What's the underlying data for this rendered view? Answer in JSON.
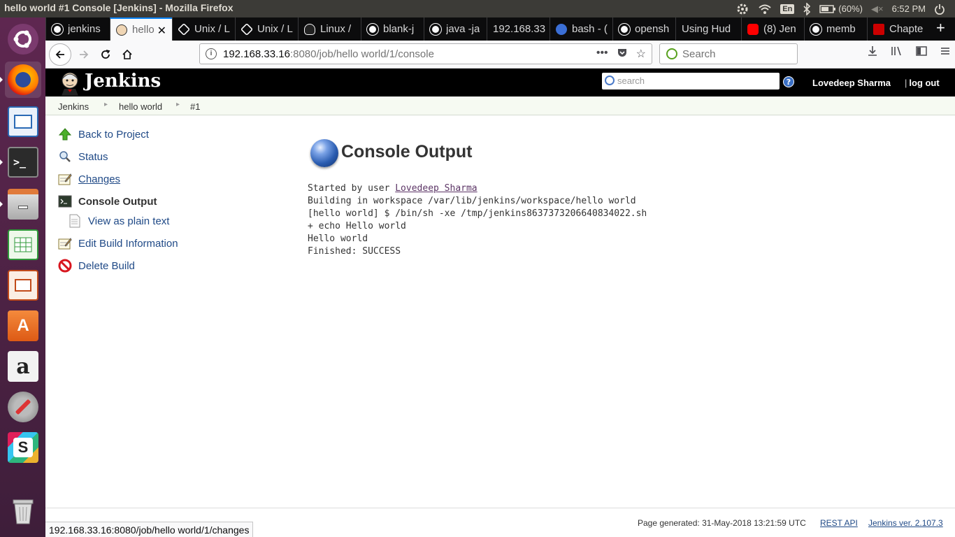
{
  "window": {
    "title": "hello world #1 Console [Jenkins] - Mozilla Firefox"
  },
  "system_tray": {
    "keyboard": "En",
    "battery": "(60%)",
    "clock": "6:52 PM"
  },
  "tabs": [
    {
      "label": "jenkins",
      "icon": "github-icon"
    },
    {
      "label": "hello",
      "icon": "jenkins-icon",
      "active": true
    },
    {
      "label": "Unix / L",
      "icon": "unix-icon"
    },
    {
      "label": "Unix / L",
      "icon": "unix-icon"
    },
    {
      "label": "Linux /",
      "icon": "linux-icon"
    },
    {
      "label": "blank-j",
      "icon": "github-icon"
    },
    {
      "label": "java -ja",
      "icon": "github-icon"
    },
    {
      "label": "192.168.33",
      "icon": "none"
    },
    {
      "label": "bash - (",
      "icon": "bash-icon"
    },
    {
      "label": "opensh",
      "icon": "github-icon"
    },
    {
      "label": "Using Hud",
      "icon": "none"
    },
    {
      "label": "(8) Jen",
      "icon": "youtube-icon"
    },
    {
      "label": "memb",
      "icon": "github-icon"
    },
    {
      "label": "Chapte",
      "icon": "redhat-icon"
    }
  ],
  "url": {
    "host": "192.168.33.16",
    "path": ":8080/job/hello world/1/console"
  },
  "browser_search": {
    "placeholder": "Search"
  },
  "jenkins": {
    "brand": "Jenkins",
    "search_placeholder": "search",
    "help": "?",
    "user": "Lovedeep Sharma",
    "logout": "log out",
    "logout_sep": "|"
  },
  "breadcrumbs": [
    "Jenkins",
    "hello world",
    "#1"
  ],
  "tasks": {
    "back": "Back to Project",
    "status": "Status",
    "changes": "Changes",
    "console": "Console Output",
    "plain": "View as plain text",
    "edit": "Edit Build Information",
    "delete": "Delete Build"
  },
  "console": {
    "heading": "Console Output",
    "started_prefix": "Started by user ",
    "started_user": "Lovedeep Sharma",
    "lines": [
      "Building in workspace /var/lib/jenkins/workspace/hello world",
      "[hello world] $ /bin/sh -xe /tmp/jenkins8637373206640834022.sh",
      "+ echo Hello world",
      "Hello world",
      "Finished: SUCCESS"
    ]
  },
  "footer": {
    "generated": "Page generated: 31-May-2018 13:21:59 UTC",
    "rest_api": "REST API",
    "version": "Jenkins ver. 2.107.3"
  },
  "status_url": "192.168.33.16:8080/job/hello world/1/changes",
  "colors": {
    "jenkins_header": "#000000",
    "link": "#204a87",
    "tab_accent": "#0a84ff",
    "launcher": "#5e2750"
  }
}
